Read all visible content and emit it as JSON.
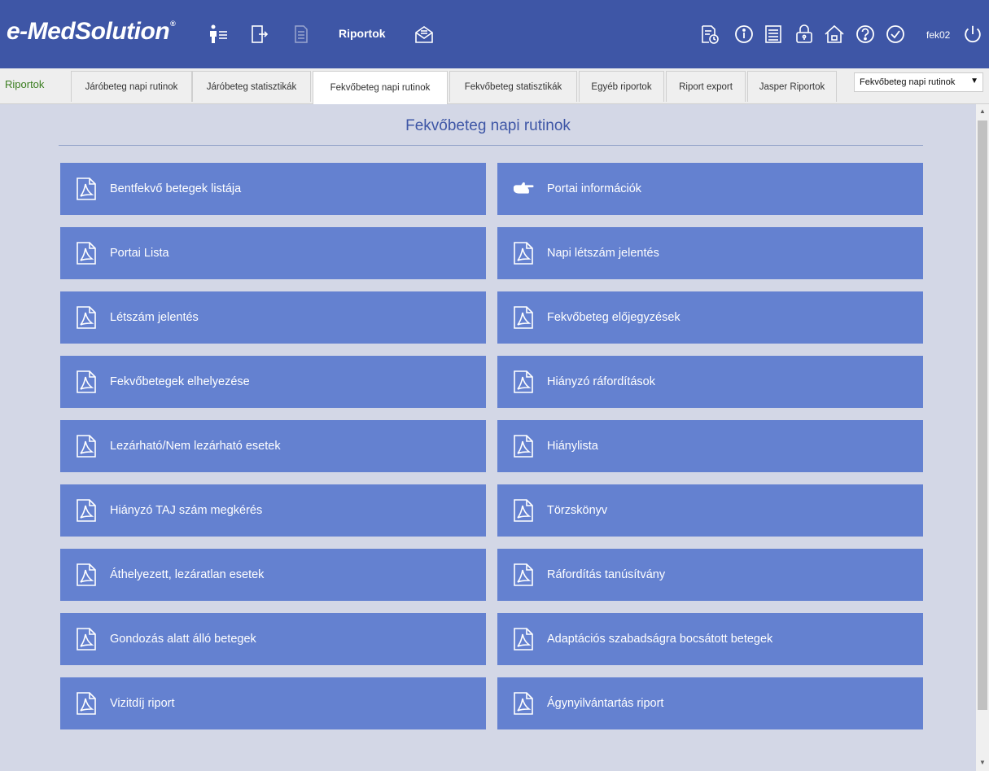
{
  "app": {
    "logo_text": "e-MedSolution",
    "logo_mark": "®"
  },
  "topbar": {
    "nav_label": "Riportok",
    "user": "fek02",
    "left_icons": [
      "patient-list-icon",
      "exit-door-icon",
      "document-icon",
      "mail-report-icon"
    ],
    "right_icons": [
      "report-clock-icon",
      "info-icon",
      "calculator-icon",
      "lock-icon",
      "home-icon",
      "help-icon",
      "check-icon",
      "power-icon"
    ]
  },
  "tabs": {
    "section_label": "Riportok",
    "items": [
      {
        "label": "Járóbeteg napi rutinok"
      },
      {
        "label": "Járóbeteg statisztikák"
      },
      {
        "label": "Fekvőbeteg napi rutinok",
        "active": true
      },
      {
        "label": "Fekvőbeteg statisztikák"
      },
      {
        "label": "Egyéb riportok"
      },
      {
        "label": "Riport export"
      },
      {
        "label": "Jasper Riportok"
      }
    ],
    "select_value": "Fekvőbeteg napi rutinok",
    "select_arrow": "▼"
  },
  "main": {
    "title": "Fekvőbeteg napi rutinok",
    "reports": [
      {
        "label": "Bentfekvő betegek listája",
        "icon": "pdf-icon"
      },
      {
        "label": "Portai információk",
        "icon": "pointing-hand-icon"
      },
      {
        "label": "Portai Lista",
        "icon": "pdf-icon"
      },
      {
        "label": "Napi létszám jelentés",
        "icon": "pdf-icon"
      },
      {
        "label": "Létszám jelentés",
        "icon": "pdf-icon"
      },
      {
        "label": "Fekvőbeteg előjegyzések",
        "icon": "pdf-icon"
      },
      {
        "label": "Fekvőbetegek elhelyezése",
        "icon": "pdf-icon"
      },
      {
        "label": "Hiányzó ráfordítások",
        "icon": "pdf-icon"
      },
      {
        "label": "Lezárható/Nem lezárható esetek",
        "icon": "pdf-icon"
      },
      {
        "label": "Hiánylista",
        "icon": "pdf-icon"
      },
      {
        "label": "Hiányzó TAJ szám megkérés",
        "icon": "pdf-icon"
      },
      {
        "label": "Törzskönyv",
        "icon": "pdf-icon"
      },
      {
        "label": "Áthelyezett, lezáratlan esetek",
        "icon": "pdf-icon"
      },
      {
        "label": "Ráfordítás tanúsítvány",
        "icon": "pdf-icon"
      },
      {
        "label": "Gondozás alatt álló betegek",
        "icon": "pdf-icon"
      },
      {
        "label": "Adaptációs szabadságra bocsátott betegek",
        "icon": "pdf-icon"
      },
      {
        "label": "Vizitdíj riport",
        "icon": "pdf-icon"
      },
      {
        "label": "Ágynyilvántartás riport",
        "icon": "pdf-icon"
      }
    ]
  },
  "colors": {
    "topbar": "#3e56a6",
    "button": "#6481d0",
    "content_bg": "#d3d7e6",
    "title": "#3e56a6",
    "section_label": "#3a7d1f"
  }
}
